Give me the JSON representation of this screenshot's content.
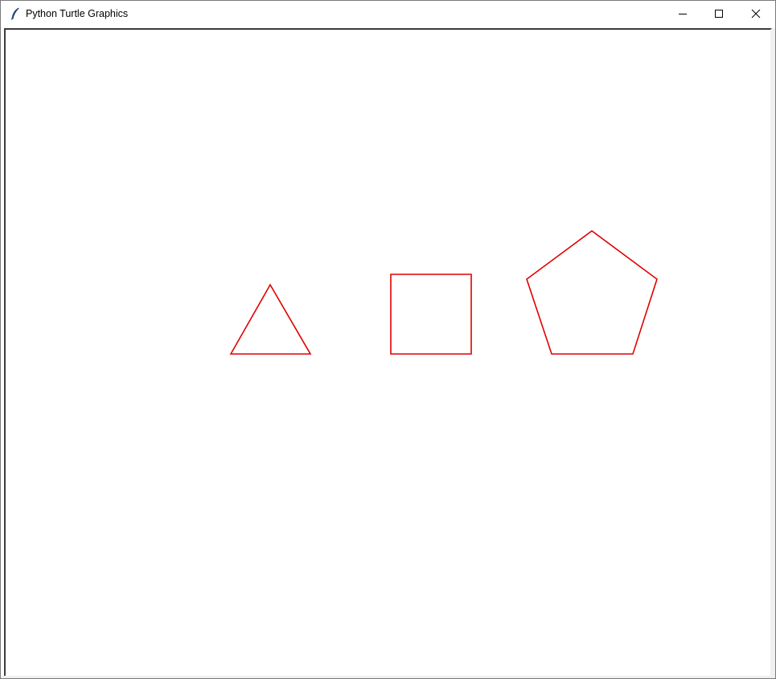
{
  "window": {
    "title": "Python Turtle Graphics",
    "app_icon": "feather-icon",
    "controls": {
      "minimize_icon": "minimize-icon",
      "maximize_icon": "maximize-icon",
      "close_icon": "close-icon"
    }
  },
  "canvas": {
    "background": "#ffffff",
    "pen_color": "#e00000",
    "shapes": [
      {
        "name": "triangle",
        "sides": 3
      },
      {
        "name": "square",
        "sides": 4
      },
      {
        "name": "pentagon",
        "sides": 5
      }
    ]
  }
}
